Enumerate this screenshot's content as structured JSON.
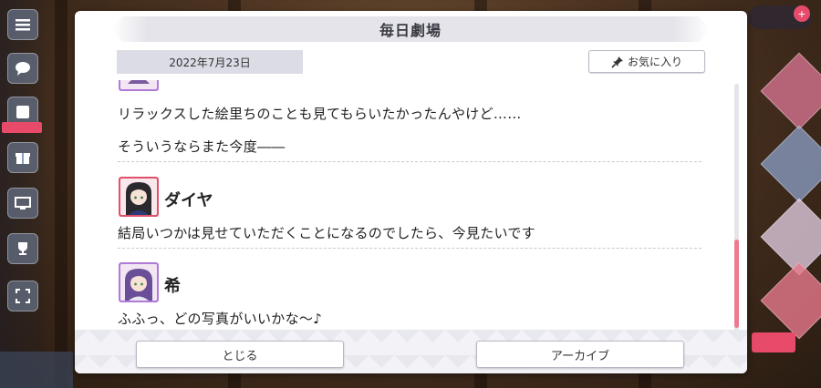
{
  "dialog": {
    "title": "毎日劇場",
    "date": "2022年7月23日",
    "favorite_label": "お気に入り",
    "close_label": "とじる",
    "archive_label": "アーカイブ"
  },
  "entries": [
    {
      "speaker": "",
      "lines": [
        "リラックスした絵里ちのことも見てもらいたかったんやけど……",
        "そういうならまた今度――"
      ]
    },
    {
      "speaker": "ダイヤ",
      "lines": [
        "結局いつかは見せていただくことになるのでしたら、今見たいです"
      ]
    },
    {
      "speaker": "希",
      "lines": [
        "ふふっ、どの写真がいいかな～♪"
      ]
    }
  ],
  "colors": {
    "accent_pink": "#ec7a90",
    "frame_dia": "#e0506a",
    "frame_nozomi": "#b07ad8"
  },
  "scroll": {
    "position_fraction": 0.95
  }
}
